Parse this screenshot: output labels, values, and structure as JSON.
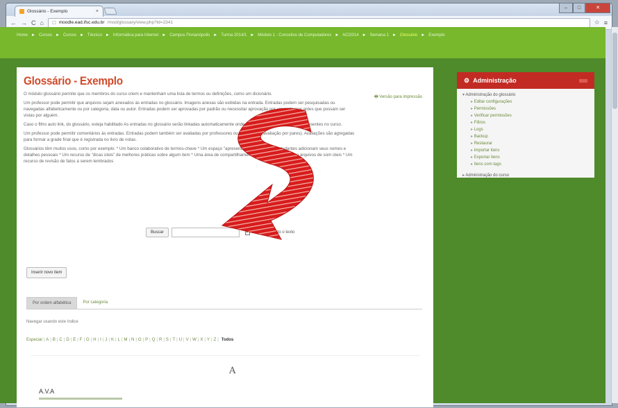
{
  "browser": {
    "tab_title": "Glossário - Exemplo",
    "url_host": "moodle.ead.ifsc.edu.br",
    "url_path": "/mod/glossary/view.php?id=2341",
    "nav_back": "←",
    "nav_forward": "→",
    "nav_reload": "C",
    "nav_home": "⌂",
    "page_icon": "☐",
    "star": "☆",
    "menu": "≡",
    "win_min": "–",
    "win_max": "□",
    "win_close": "✕",
    "tab_close": "×"
  },
  "breadcrumb": {
    "items": [
      "Home",
      "Cursos",
      "Cursos",
      "Técnico",
      "Informática para Internet",
      "Campus Florianópolis",
      "Turma 2014/1",
      "Módulo 1 - Conceitos de Computadores",
      "ACI2014",
      "Semana 1",
      "Glossário",
      "Exemplo"
    ],
    "sep": "►"
  },
  "main": {
    "title": "Glossário - Exemplo",
    "print_link": "Versão para impressão",
    "paragraphs": [
      "O módulo glossário permite que os membros do curso criem e mantenham uma lista de termos ou definições, como um dicionário.",
      "Um professor pode permitir que arquivos sejam anexados às entradas no glossário. Imagens anexas são exibidas na entrada. Entradas podem ser pesquisadas ou navegadas alfabeticamente ou por categoria, data ou autor. Entradas podem ser aprovadas por padrão ou necessitar aprovação por um professor antes que possam ser vistas por alguém.",
      "Caso o filtro auto link, do glossário, esteja habilitado As entradas no glossário serão linkadas automaticamente onde as palavras e frases se fazem presentes no curso.",
      "Um professor pode permitir comentários às entradas. Entradas podem também ser avaliadas por professores ou estudantes (avaliação por pares). Avaliações são agregadas para formar a grade final que é registrada no livro de notas.",
      "Glossários têm muitos usos, como por exemplo: * Um banco colaborativo de termos-chave * Um espaço \"apresente-se\" onde novos estudantes adicionam seus nomes e detalhes pessoais * Um recurso de \"dicas úteis\" de melhores práticas sobre algum item * Uma área de compartilhamento de vídeos, imagens ou arquivos de som úteis * Um recurso de revisão de fatos a serem lembrados"
    ],
    "search_button": "Buscar",
    "search_value": "",
    "full_search_label": "Buscar em todo o texto",
    "add_entry_button": "Inserir novo item",
    "tabs": [
      "Por ordem alfabética",
      "Por categoria"
    ],
    "browse_label": "Navegar usando este índice",
    "letters": [
      "Especial",
      "A",
      "B",
      "C",
      "D",
      "E",
      "F",
      "G",
      "H",
      "I",
      "J",
      "K",
      "L",
      "M",
      "N",
      "O",
      "P",
      "Q",
      "R",
      "S",
      "T",
      "U",
      "V",
      "W",
      "X",
      "Y",
      "Z"
    ],
    "all_label": "Todos",
    "letter_heading": "A",
    "entry_title": "A.V.A"
  },
  "admin": {
    "title": "Administração",
    "section": "Administração do glossário",
    "items": [
      "Editar configurações",
      "Permissões",
      "Verificar permissões",
      "Filtros",
      "Logs",
      "Backup",
      "Restaurar",
      "Importar itens",
      "Exportar itens",
      "Itens com tags"
    ],
    "course_admin": "Administração do curso"
  },
  "annotation": {
    "color": "#d81c1c"
  }
}
